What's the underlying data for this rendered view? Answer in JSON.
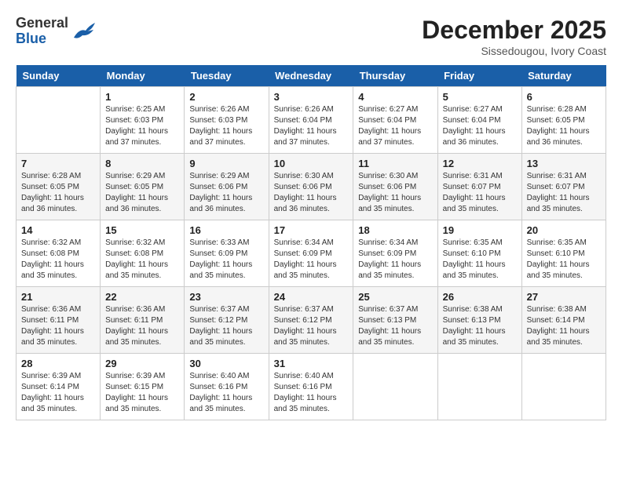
{
  "header": {
    "logo_line1": "General",
    "logo_line2": "Blue",
    "month": "December 2025",
    "location": "Sissedougou, Ivory Coast"
  },
  "weekdays": [
    "Sunday",
    "Monday",
    "Tuesday",
    "Wednesday",
    "Thursday",
    "Friday",
    "Saturday"
  ],
  "weeks": [
    [
      {
        "day": "",
        "info": ""
      },
      {
        "day": "1",
        "info": "Sunrise: 6:25 AM\nSunset: 6:03 PM\nDaylight: 11 hours and 37 minutes."
      },
      {
        "day": "2",
        "info": "Sunrise: 6:26 AM\nSunset: 6:03 PM\nDaylight: 11 hours and 37 minutes."
      },
      {
        "day": "3",
        "info": "Sunrise: 6:26 AM\nSunset: 6:04 PM\nDaylight: 11 hours and 37 minutes."
      },
      {
        "day": "4",
        "info": "Sunrise: 6:27 AM\nSunset: 6:04 PM\nDaylight: 11 hours and 37 minutes."
      },
      {
        "day": "5",
        "info": "Sunrise: 6:27 AM\nSunset: 6:04 PM\nDaylight: 11 hours and 36 minutes."
      },
      {
        "day": "6",
        "info": "Sunrise: 6:28 AM\nSunset: 6:05 PM\nDaylight: 11 hours and 36 minutes."
      }
    ],
    [
      {
        "day": "7",
        "info": "Sunrise: 6:28 AM\nSunset: 6:05 PM\nDaylight: 11 hours and 36 minutes."
      },
      {
        "day": "8",
        "info": "Sunrise: 6:29 AM\nSunset: 6:05 PM\nDaylight: 11 hours and 36 minutes."
      },
      {
        "day": "9",
        "info": "Sunrise: 6:29 AM\nSunset: 6:06 PM\nDaylight: 11 hours and 36 minutes."
      },
      {
        "day": "10",
        "info": "Sunrise: 6:30 AM\nSunset: 6:06 PM\nDaylight: 11 hours and 36 minutes."
      },
      {
        "day": "11",
        "info": "Sunrise: 6:30 AM\nSunset: 6:06 PM\nDaylight: 11 hours and 35 minutes."
      },
      {
        "day": "12",
        "info": "Sunrise: 6:31 AM\nSunset: 6:07 PM\nDaylight: 11 hours and 35 minutes."
      },
      {
        "day": "13",
        "info": "Sunrise: 6:31 AM\nSunset: 6:07 PM\nDaylight: 11 hours and 35 minutes."
      }
    ],
    [
      {
        "day": "14",
        "info": "Sunrise: 6:32 AM\nSunset: 6:08 PM\nDaylight: 11 hours and 35 minutes."
      },
      {
        "day": "15",
        "info": "Sunrise: 6:32 AM\nSunset: 6:08 PM\nDaylight: 11 hours and 35 minutes."
      },
      {
        "day": "16",
        "info": "Sunrise: 6:33 AM\nSunset: 6:09 PM\nDaylight: 11 hours and 35 minutes."
      },
      {
        "day": "17",
        "info": "Sunrise: 6:34 AM\nSunset: 6:09 PM\nDaylight: 11 hours and 35 minutes."
      },
      {
        "day": "18",
        "info": "Sunrise: 6:34 AM\nSunset: 6:09 PM\nDaylight: 11 hours and 35 minutes."
      },
      {
        "day": "19",
        "info": "Sunrise: 6:35 AM\nSunset: 6:10 PM\nDaylight: 11 hours and 35 minutes."
      },
      {
        "day": "20",
        "info": "Sunrise: 6:35 AM\nSunset: 6:10 PM\nDaylight: 11 hours and 35 minutes."
      }
    ],
    [
      {
        "day": "21",
        "info": "Sunrise: 6:36 AM\nSunset: 6:11 PM\nDaylight: 11 hours and 35 minutes."
      },
      {
        "day": "22",
        "info": "Sunrise: 6:36 AM\nSunset: 6:11 PM\nDaylight: 11 hours and 35 minutes."
      },
      {
        "day": "23",
        "info": "Sunrise: 6:37 AM\nSunset: 6:12 PM\nDaylight: 11 hours and 35 minutes."
      },
      {
        "day": "24",
        "info": "Sunrise: 6:37 AM\nSunset: 6:12 PM\nDaylight: 11 hours and 35 minutes."
      },
      {
        "day": "25",
        "info": "Sunrise: 6:37 AM\nSunset: 6:13 PM\nDaylight: 11 hours and 35 minutes."
      },
      {
        "day": "26",
        "info": "Sunrise: 6:38 AM\nSunset: 6:13 PM\nDaylight: 11 hours and 35 minutes."
      },
      {
        "day": "27",
        "info": "Sunrise: 6:38 AM\nSunset: 6:14 PM\nDaylight: 11 hours and 35 minutes."
      }
    ],
    [
      {
        "day": "28",
        "info": "Sunrise: 6:39 AM\nSunset: 6:14 PM\nDaylight: 11 hours and 35 minutes."
      },
      {
        "day": "29",
        "info": "Sunrise: 6:39 AM\nSunset: 6:15 PM\nDaylight: 11 hours and 35 minutes."
      },
      {
        "day": "30",
        "info": "Sunrise: 6:40 AM\nSunset: 6:16 PM\nDaylight: 11 hours and 35 minutes."
      },
      {
        "day": "31",
        "info": "Sunrise: 6:40 AM\nSunset: 6:16 PM\nDaylight: 11 hours and 35 minutes."
      },
      {
        "day": "",
        "info": ""
      },
      {
        "day": "",
        "info": ""
      },
      {
        "day": "",
        "info": ""
      }
    ]
  ]
}
